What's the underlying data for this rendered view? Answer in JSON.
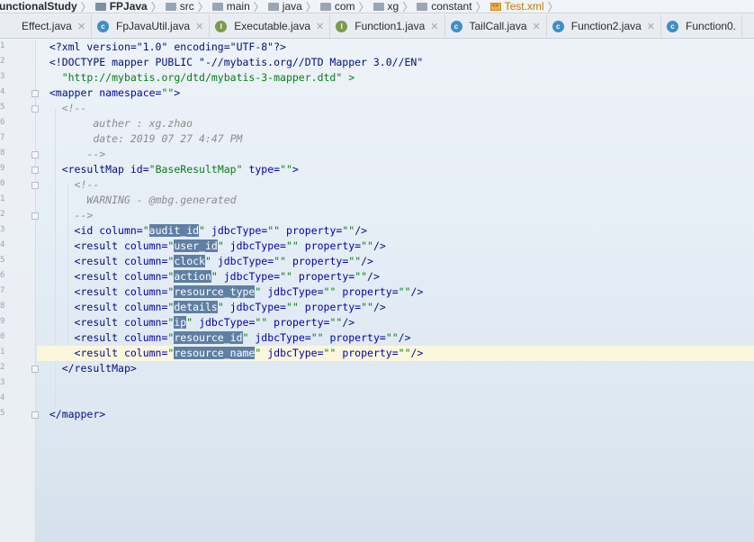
{
  "breadcrumb": [
    {
      "label": "unctionalStudy",
      "icon": "none"
    },
    {
      "label": "FPJava",
      "icon": "project-folder-icon"
    },
    {
      "label": "src",
      "icon": "folder-icon"
    },
    {
      "label": "main",
      "icon": "folder-icon"
    },
    {
      "label": "java",
      "icon": "folder-icon"
    },
    {
      "label": "com",
      "icon": "folder-icon"
    },
    {
      "label": "xg",
      "icon": "folder-icon"
    },
    {
      "label": "constant",
      "icon": "folder-icon"
    },
    {
      "label": "Test.xml",
      "icon": "xml-file-icon"
    }
  ],
  "tabs": [
    {
      "label": "Effect.java",
      "icon": "none"
    },
    {
      "label": "FpJavaUtil.java",
      "icon": "class-icon"
    },
    {
      "label": "Executable.java",
      "icon": "interface-icon"
    },
    {
      "label": "Function1.java",
      "icon": "interface-icon"
    },
    {
      "label": "TailCall.java",
      "icon": "class-icon"
    },
    {
      "label": "Function2.java",
      "icon": "class-icon"
    },
    {
      "label": "Function0.",
      "icon": "class-icon"
    }
  ],
  "line_numbers": [
    "1",
    "2",
    "3",
    "4",
    "5",
    "6",
    "7",
    "8",
    "9",
    "0",
    "1",
    "2",
    "3",
    "4",
    "5",
    "6",
    "7",
    "8",
    "9",
    "0",
    "1",
    "2",
    "3",
    "4",
    "5"
  ],
  "code": {
    "xml_decl": "<?xml version=\"1.0\" encoding=\"UTF-8\"?>",
    "doctype_1": "<!DOCTYPE mapper PUBLIC \"-//mybatis.org//DTD Mapper 3.0//EN\"",
    "doctype_2": "\"http://mybatis.org/dtd/mybatis-3-mapper.dtd\" >",
    "mapper_open_tag": "<mapper ",
    "mapper_attr": "namespace=",
    "mapper_val": "\"\"",
    "mapper_close": ">",
    "comment_open_1": "<!--",
    "comment_author": "auther : xg.zhao",
    "comment_date": "date: 2019 07 27 4:47 PM",
    "comment_close_1": "-->",
    "resultmap_tag": "<resultMap ",
    "resultmap_id_attr": "id=",
    "resultmap_id_val": "\"BaseResultMap\"",
    "resultmap_type_attr": " type=",
    "resultmap_type_val": "\"\"",
    "resultmap_gt": ">",
    "comment_open_2": "<!--",
    "comment_warning": "WARNING - @mbg.generated",
    "comment_close_2": "-->",
    "id_tag": "<id ",
    "result_tag": "<result ",
    "column_attr": "column=",
    "jdbc_attr": " jdbcType=",
    "prop_attr": " property=",
    "empty_val": "\"\"",
    "quote": "\"",
    "self_close": "/>",
    "columns": [
      "audit_id",
      "user_id",
      "clock",
      "action",
      "resource_type",
      "details",
      "ip",
      "resource_id",
      "resource_name"
    ],
    "resultmap_end": "</resultMap>",
    "mapper_end": "</mapper>"
  },
  "colors": {
    "tag": "#00107e",
    "attribute": "#0000aa",
    "string": "#067d17",
    "comment": "#8c8c8c",
    "selection": "#5f7fa5",
    "current_line": "#fbf7dd"
  }
}
